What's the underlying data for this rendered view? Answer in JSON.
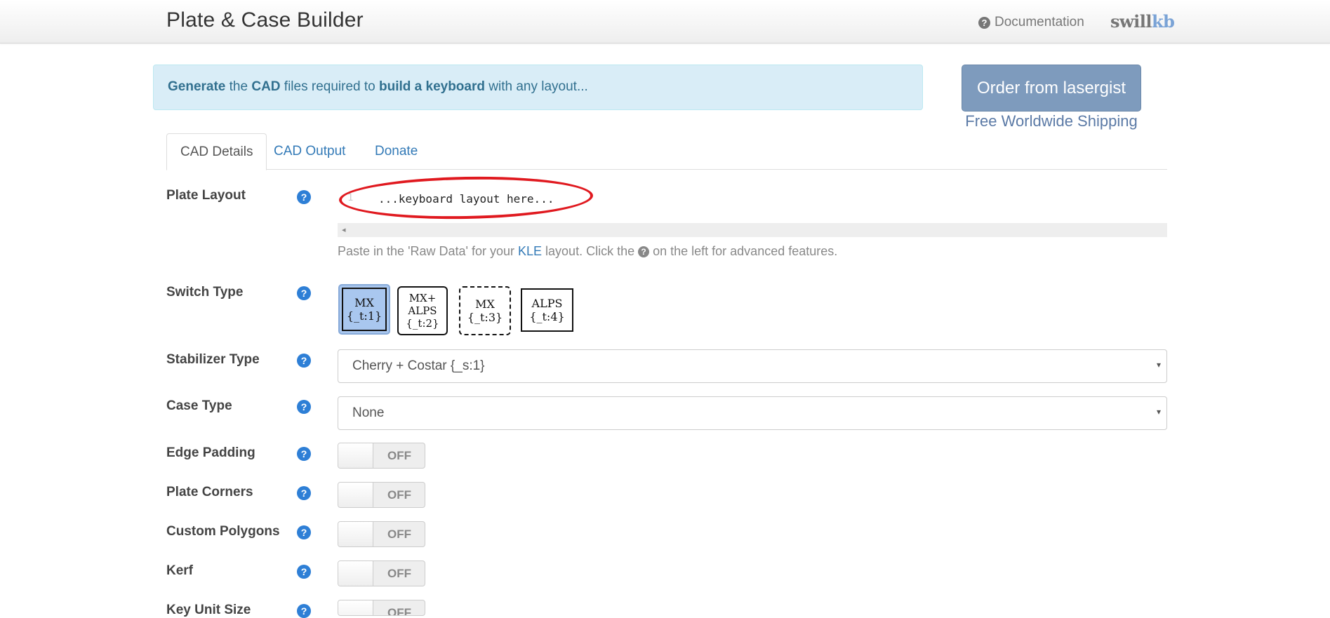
{
  "header": {
    "title": "Plate & Case Builder",
    "documentation_label": "Documentation",
    "logo_part1": "swill",
    "logo_part2": "kb"
  },
  "banner": {
    "w1": "Generate",
    "w2": " the ",
    "w3": "CAD",
    "w4": " files required to ",
    "w5": "build a keyboard",
    "w6": " with any layout..."
  },
  "order": {
    "button_label": "Order from lasergist",
    "shipping": "Free Worldwide Shipping"
  },
  "tabs": [
    {
      "label": "CAD Details",
      "active": true
    },
    {
      "label": "CAD Output",
      "active": false
    },
    {
      "label": "Donate",
      "active": false
    }
  ],
  "plate_layout": {
    "label": "Plate Layout",
    "line_number": "1",
    "placeholder": "...keyboard layout here...",
    "help_a": "Paste in the 'Raw Data' for your",
    "help_link": "KLE",
    "help_b": "layout. Click the",
    "help_c": "on the left for advanced features."
  },
  "switch_type": {
    "label": "Switch Type",
    "options": [
      {
        "line1": "MX",
        "line2": "{_t:1}",
        "selected": true
      },
      {
        "line1": "MX+",
        "line2": "ALPS",
        "line3": "{_t:2}"
      },
      {
        "line1": "MX",
        "line2": "{_t:3}"
      },
      {
        "line1": "ALPS",
        "line2": "{_t:4}"
      }
    ]
  },
  "stabilizer_type": {
    "label": "Stabilizer Type",
    "value": "Cherry + Costar {_s:1}"
  },
  "case_type": {
    "label": "Case Type",
    "value": "None"
  },
  "toggles": [
    {
      "label": "Edge Padding",
      "state": "OFF"
    },
    {
      "label": "Plate Corners",
      "state": "OFF"
    },
    {
      "label": "Custom Polygons",
      "state": "OFF"
    },
    {
      "label": "Kerf",
      "state": "OFF"
    },
    {
      "label": "Key Unit Size",
      "state": "OFF"
    }
  ],
  "icons": {
    "help": "?",
    "caret": "▾",
    "scroll_left": "◂"
  },
  "colors": {
    "accent": "#337ab7",
    "help_icon": "#2e7fd6",
    "alert_bg": "#d9edf7",
    "order_btn": "#7e9bbd",
    "annotation": "#e0191f"
  }
}
